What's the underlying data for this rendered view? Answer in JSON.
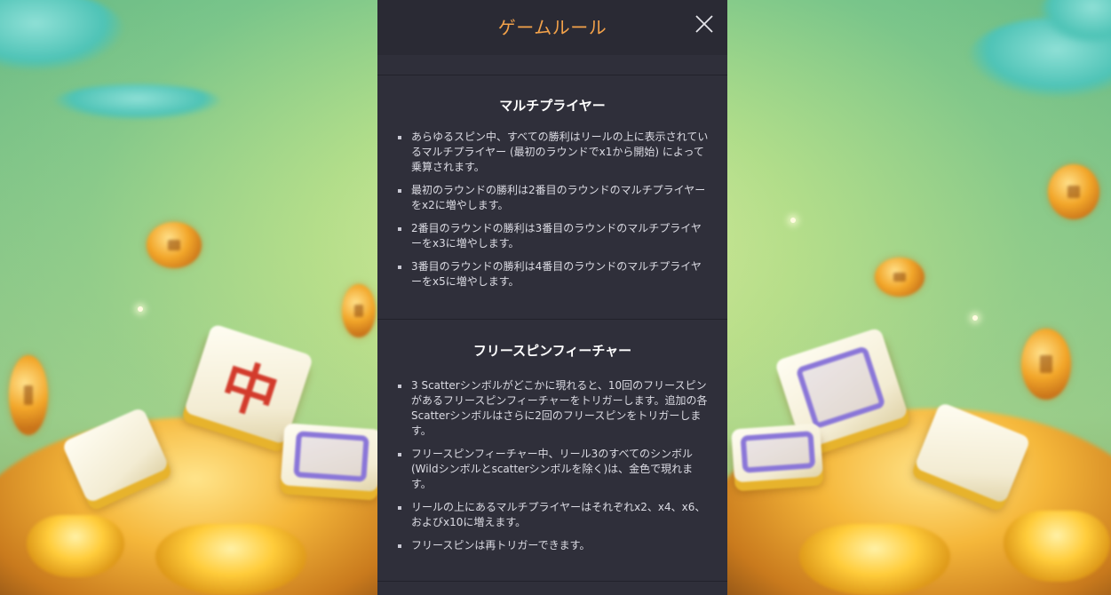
{
  "panel": {
    "title": "ゲームルール",
    "close_icon": "close-icon"
  },
  "sections": [
    {
      "title": "マルチプライヤー",
      "rules": [
        "あらゆるスピン中、すべての勝利はリールの上に表示されているマルチプライヤー (最初のラウンドでx1から開始) によって乗算されます。",
        "最初のラウンドの勝利は2番目のラウンドのマルチプライヤーをx2に増やします。",
        "2番目のラウンドの勝利は3番目のラウンドのマルチプライヤーをx3に増やします。",
        "3番目のラウンドの勝利は4番目のラウンドのマルチプライヤーをx5に増やします。"
      ]
    },
    {
      "title": "フリースピンフィーチャー",
      "rules": [
        "3 Scatterシンボルがどこかに現れると、10回のフリースピンがあるフリースピンフィーチャーをトリガーします。追加の各Scatterシンボルはさらに2回のフリースピンをトリガーします。",
        "フリースピンフィーチャー中、リール3のすべてのシンボル (Wildシンボルとscatterシンボルを除く)は、金色で現れます。",
        "リールの上にあるマルチプライヤーはそれぞれx2、x4、x6、およびx10に増えます。",
        "フリースピンは再トリガーできます。"
      ]
    }
  ],
  "background": {
    "tile_glyph": "中"
  },
  "colors": {
    "panel_bg": "#2f2f3a",
    "header_bg": "#2a2a34",
    "title": "#f3a24a",
    "text": "#dcdce4"
  }
}
